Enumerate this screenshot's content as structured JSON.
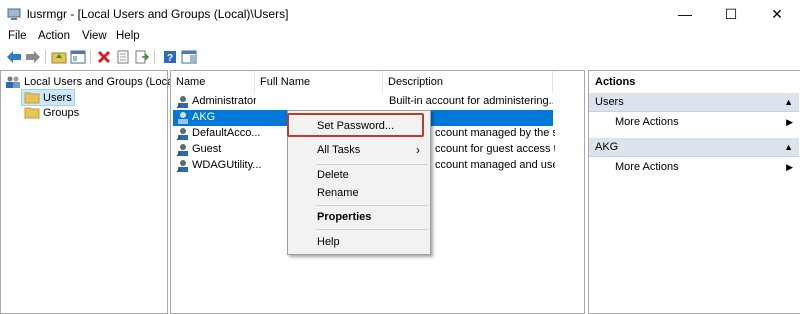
{
  "window": {
    "title": "lusrmgr - [Local Users and Groups (Local)\\Users]"
  },
  "window_controls": {
    "minimize": "—",
    "maximize": "☐",
    "close": "✕"
  },
  "menu": [
    "File",
    "Action",
    "View",
    "Help"
  ],
  "tree": {
    "root": "Local Users and Groups (Local)",
    "items": [
      "Users",
      "Groups"
    ]
  },
  "list": {
    "columns": [
      "Name",
      "Full Name",
      "Description"
    ],
    "rows": [
      {
        "name": "Administrator",
        "full_name": "",
        "description": "Built-in account for administering..."
      },
      {
        "name": "AKG",
        "full_name": "",
        "description": ""
      },
      {
        "name": "DefaultAcco...",
        "full_name": "",
        "description": "ccount managed by the s..."
      },
      {
        "name": "Guest",
        "full_name": "",
        "description": "ccount for guest access t..."
      },
      {
        "name": "WDAGUtility...",
        "full_name": "",
        "description": "ccount managed and use..."
      }
    ]
  },
  "context_menu": {
    "set_password": "Set Password...",
    "all_tasks": "All Tasks",
    "delete": "Delete",
    "rename": "Rename",
    "properties": "Properties",
    "help": "Help"
  },
  "actions": {
    "header": "Actions",
    "sections": [
      {
        "title": "Users",
        "item": "More Actions"
      },
      {
        "title": "AKG",
        "item": "More Actions"
      }
    ]
  },
  "colors": {
    "selection": "#0078d7",
    "highlight_box": "#c0392b",
    "actions_section": "#dbe4ee"
  }
}
